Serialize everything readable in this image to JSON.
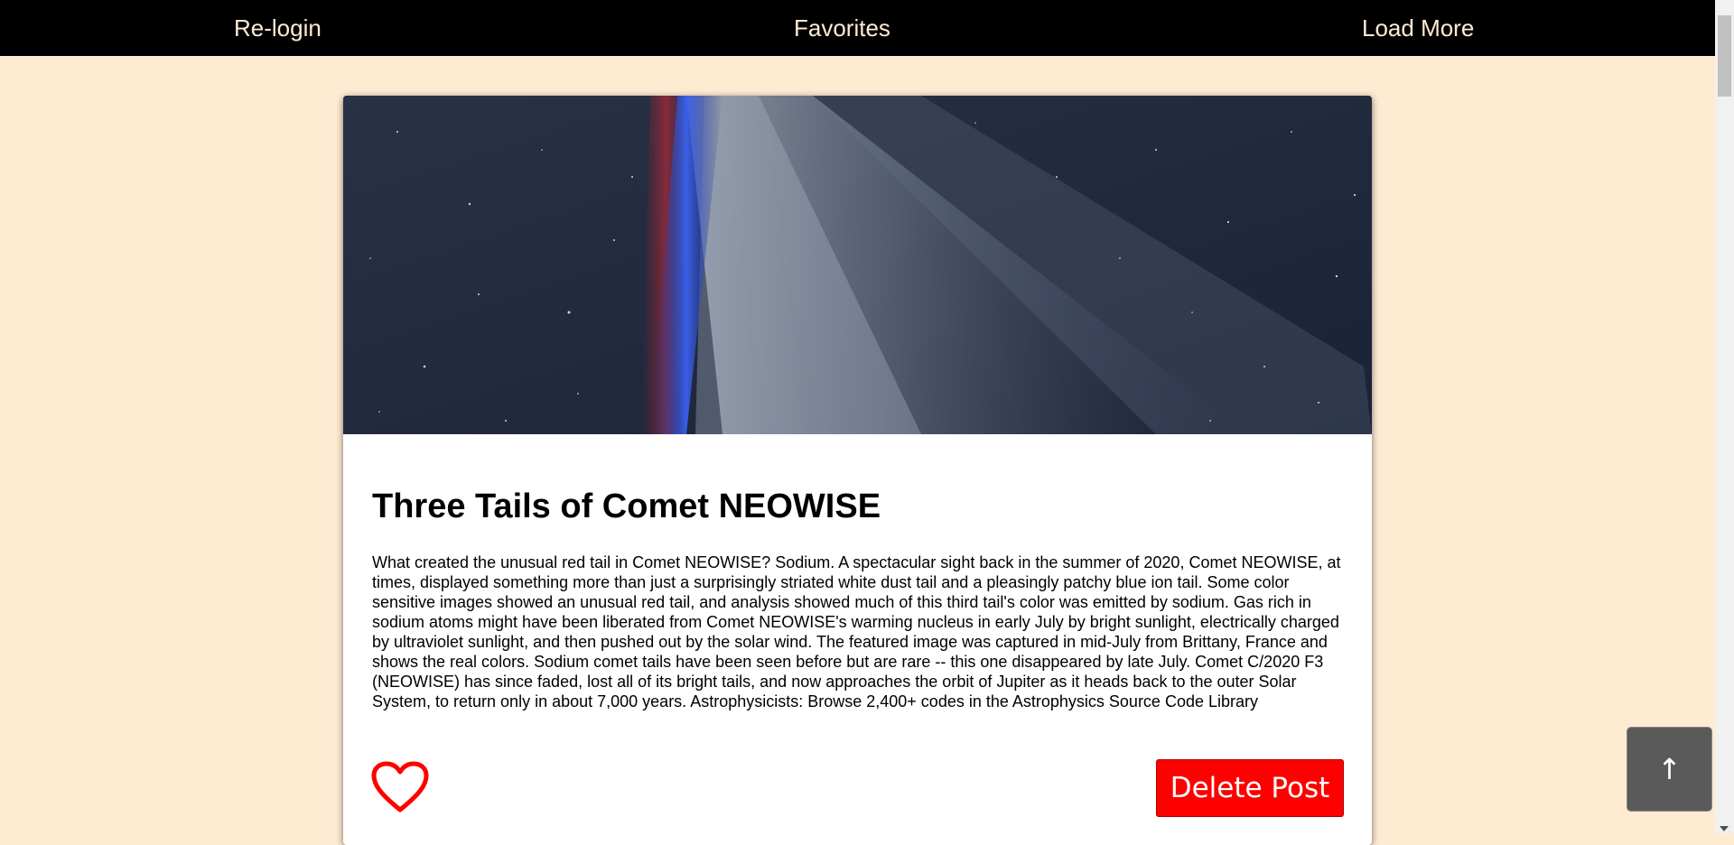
{
  "nav": {
    "relogin_label": "Re-login",
    "favorites_label": "Favorites",
    "load_more_label": "Load More"
  },
  "post": {
    "title": "Three Tails of Comet NEOWISE",
    "explanation": "What created the unusual red tail in Comet NEOWISE? Sodium. A spectacular sight back in the summer of 2020, Comet NEOWISE, at times, displayed something more than just a surprisingly striated white dust tail and a pleasingly patchy blue ion tail. Some color sensitive images showed an unusual red tail, and analysis showed much of this third tail's color was emitted by sodium. Gas rich in sodium atoms might have been liberated from Comet NEOWISE's warming nucleus in early July by bright sunlight, electrically charged by ultraviolet sunlight, and then pushed out by the solar wind. The featured image was captured in mid-July from Brittany, France and shows the real colors. Sodium comet tails have been seen before but are rare -- this one disappeared by late July. Comet C/2020 F3 (NEOWISE) has since faded, lost all of its bright tails, and now approaches the orbit of Jupiter as it heads back to the outer Solar System, to return only in about 7,000 years. Astrophysicists: Browse 2,400+ codes in the Astrophysics Source Code Library",
    "favorite_icon": "heart-outline-icon",
    "delete_label": "Delete Post"
  },
  "scroll_top": {
    "label": "↑"
  },
  "colors": {
    "page_background": "#ffebd2",
    "navbar_background": "#000000",
    "navbar_text": "#ffebd2",
    "delete_button": "#fe0000",
    "heart": "#ff0000",
    "scroll_top_button": "#5a5a5a"
  }
}
